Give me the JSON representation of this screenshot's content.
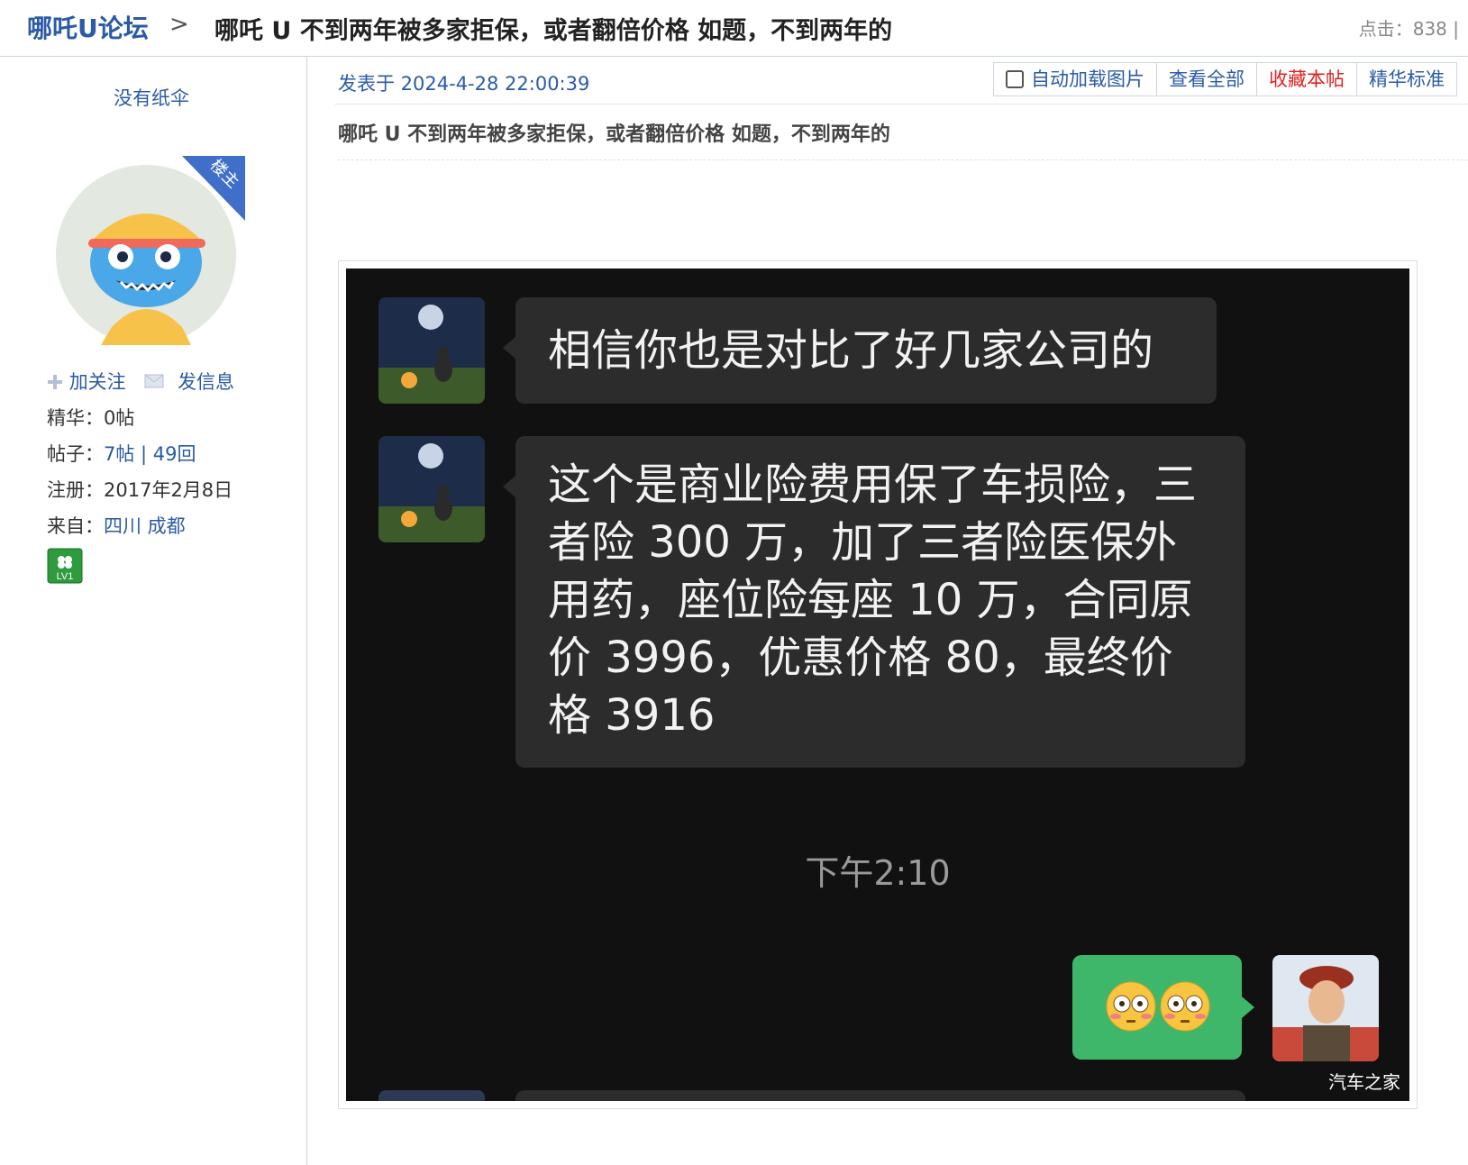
{
  "header": {
    "forum_name": "哪吒U论坛",
    "separator": ">",
    "thread_title": "哪吒 U 不到两年被多家拒保，或者翻倍价格 如题，不到两年的",
    "hits": "点击：838 |"
  },
  "author": {
    "username": "没有纸伞",
    "badge": "楼主",
    "follow": "加关注",
    "message": "发信息",
    "digest_label": "精华：",
    "digest_value": "0帖",
    "posts_label": "帖子：",
    "posts_value": "7帖 | 49回",
    "register_label": "注册：",
    "register_value": "2017年2月8日",
    "from_label": "来自：",
    "from_value": "四川 成都",
    "level": "LV1"
  },
  "post": {
    "posted_at": "发表于 2024-4-28 22:00:39",
    "toolbar": {
      "auto_load": "自动加载图片",
      "view_all": "查看全部",
      "favorite": "收藏本帖",
      "digest": "精华标准"
    },
    "title": "哪吒 U 不到两年被多家拒保，或者翻倍价格 如题，不到两年的"
  },
  "chat": {
    "msg1": "相信你也是对比了好几家公司的",
    "msg2": "这个是商业险费用保了车损险，三者险 300 万，加了三者险医保外用药，座位险每座 10 万，合同原价 3996，优惠价格 80，最终价格 3916",
    "timestamp": "下午2:10",
    "watermark": "汽车之家"
  },
  "colors": {
    "link_blue": "#2b5aa6",
    "favorite_red": "#e02020",
    "chat_bg": "#111111",
    "bubble_gray": "#2c2c2c",
    "bubble_green": "#3fb76b"
  }
}
